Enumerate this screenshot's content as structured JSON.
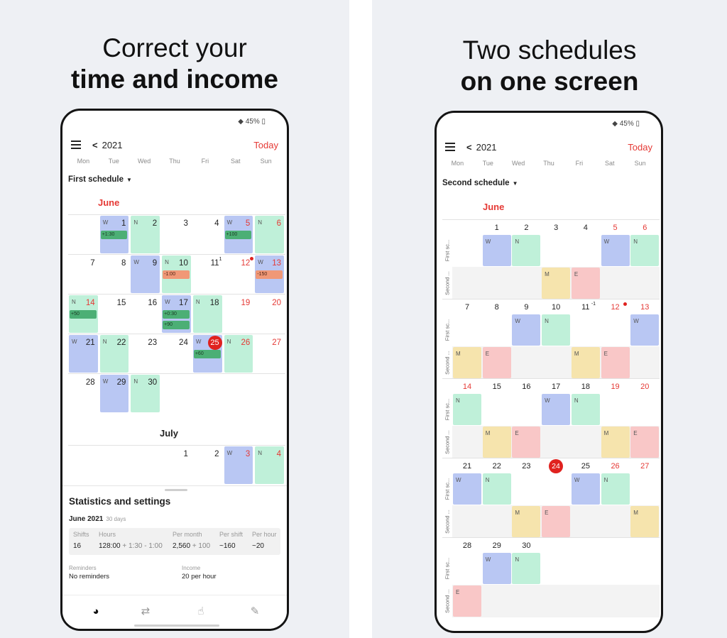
{
  "left": {
    "headline": {
      "line1": "Correct your",
      "line2": "time and income"
    },
    "status": {
      "battery": "◆ 45% ▯"
    },
    "header": {
      "back": "<",
      "year": "2021",
      "today": "Today"
    },
    "weekdays": [
      "Mon",
      "Tue",
      "Wed",
      "Thu",
      "Fri",
      "Sat",
      "Sun"
    ],
    "schedule_select": "First schedule",
    "months": {
      "june": "June",
      "july": "July"
    },
    "calendar": {
      "june": [
        {
          "day": "1",
          "shift": "W",
          "pill": "+1:30",
          "pill_color": "green"
        },
        {
          "day": "2",
          "shift": "N"
        },
        {
          "day": "3"
        },
        {
          "day": "4"
        },
        {
          "day": "5",
          "shift": "W",
          "red": true,
          "pill": "+100",
          "pill_color": "green"
        },
        {
          "day": "6",
          "shift": "N",
          "red": true
        },
        {
          "day": "7"
        },
        {
          "day": "8"
        },
        {
          "day": "9",
          "shift": "W"
        },
        {
          "day": "10",
          "shift": "N",
          "pill": "-1:00",
          "pill_color": "orange"
        },
        {
          "day": "11",
          "sup": "1"
        },
        {
          "day": "12",
          "red": true,
          "dot": true
        },
        {
          "day": "13",
          "shift": "W",
          "red": true,
          "pill": "-150",
          "pill_color": "orange"
        },
        {
          "day": "14",
          "shift": "N",
          "red": true,
          "pill": "+50",
          "pill_color": "green"
        },
        {
          "day": "15"
        },
        {
          "day": "16"
        },
        {
          "day": "17",
          "shift": "W",
          "pill": "+0:30",
          "pill2": "+90",
          "pill_color": "green"
        },
        {
          "day": "18",
          "shift": "N"
        },
        {
          "day": "19",
          "red": true
        },
        {
          "day": "20",
          "red": true
        },
        {
          "day": "21",
          "shift": "W"
        },
        {
          "day": "22",
          "shift": "N"
        },
        {
          "day": "23"
        },
        {
          "day": "24"
        },
        {
          "day": "25",
          "shift": "W",
          "today": true,
          "pill": "+60",
          "pill_color": "green"
        },
        {
          "day": "26",
          "shift": "N",
          "red": true
        },
        {
          "day": "27",
          "red": true
        },
        {
          "day": "28"
        },
        {
          "day": "29",
          "shift": "W"
        },
        {
          "day": "30",
          "shift": "N"
        }
      ],
      "july": [
        {
          "day": "1"
        },
        {
          "day": "2"
        },
        {
          "day": "3",
          "shift": "W",
          "red": true
        },
        {
          "day": "4",
          "shift": "N",
          "red": true
        }
      ]
    },
    "stats": {
      "title": "Statistics and settings",
      "period": "June 2021",
      "period_days": "30 days",
      "shifts_h": "Shifts",
      "shifts_v": "16",
      "hours_h": "Hours",
      "hours_v": "128:00",
      "hours_sub": "+ 1:30 - 1:00",
      "per_month_h": "Per month",
      "per_month_v": "2,560",
      "per_month_sub": "+ 100",
      "per_shift_h": "Per shift",
      "per_shift_v": "~160",
      "per_hour_h": "Per hour",
      "per_hour_v": "~20",
      "reminders_h": "Reminders",
      "reminders_v": "No reminders",
      "income_h": "Income",
      "income_v": "20 per hour"
    },
    "nav_icons": [
      "clock-icon",
      "repeat-icon",
      "touch-icon",
      "magic-wand-icon"
    ],
    "nav_glyphs": [
      "◕",
      "⇄",
      "☝",
      "✎"
    ]
  },
  "right": {
    "headline": {
      "line1": "Two schedules",
      "line2": "on one screen"
    },
    "status": {
      "battery": "◆ 45% ▯"
    },
    "header": {
      "back": "<",
      "year": "2021",
      "today": "Today"
    },
    "weekdays": [
      "Mon",
      "Tue",
      "Wed",
      "Thu",
      "Fri",
      "Sat",
      "Sun"
    ],
    "schedule_select": "Second schedule",
    "months": {
      "june": "June"
    },
    "row_labels": {
      "first": "First sc...",
      "second": "Second ..."
    },
    "weeks": [
      {
        "days": [
          "",
          "1",
          "2",
          "3",
          "4",
          "5",
          "6"
        ],
        "red": [
          5,
          6
        ],
        "first": [
          "",
          "W",
          "N",
          "",
          "",
          "W",
          "N"
        ],
        "second": [
          "",
          "",
          "",
          "M",
          "E",
          "",
          ""
        ]
      },
      {
        "days": [
          "7",
          "8",
          "9",
          "10",
          "11",
          "12",
          "13"
        ],
        "red": [
          5,
          6
        ],
        "sup": {
          "4": "-1"
        },
        "dot": 5,
        "first": [
          "",
          "",
          "W",
          "N",
          "",
          "",
          "W"
        ],
        "second": [
          "M",
          "E",
          "",
          "",
          "M",
          "E",
          ""
        ]
      },
      {
        "days": [
          "14",
          "15",
          "16",
          "17",
          "18",
          "19",
          "20"
        ],
        "red": [
          0,
          5,
          6
        ],
        "first": [
          "N",
          "",
          "",
          "W",
          "N",
          "",
          ""
        ],
        "second": [
          "",
          "M",
          "E",
          "",
          "",
          "M",
          "E"
        ]
      },
      {
        "days": [
          "21",
          "22",
          "23",
          "24",
          "25",
          "26",
          "27"
        ],
        "red": [
          5,
          6
        ],
        "today": 3,
        "first": [
          "W",
          "N",
          "",
          "",
          "W",
          "N",
          ""
        ],
        "second": [
          "",
          "",
          "M",
          "E",
          "",
          "",
          "M"
        ]
      },
      {
        "days": [
          "28",
          "29",
          "30",
          "",
          "",
          "",
          ""
        ],
        "red": [],
        "first": [
          "",
          "W",
          "N",
          "",
          "",
          "",
          ""
        ],
        "second": [
          "E",
          "",
          "",
          "",
          "",
          "",
          ""
        ]
      }
    ]
  },
  "colors": {
    "W": "#b9c7f3",
    "N": "#bff0d9",
    "M": "#f6e4ad",
    "E": "#f9c7c7",
    "accent": "#e53935"
  }
}
